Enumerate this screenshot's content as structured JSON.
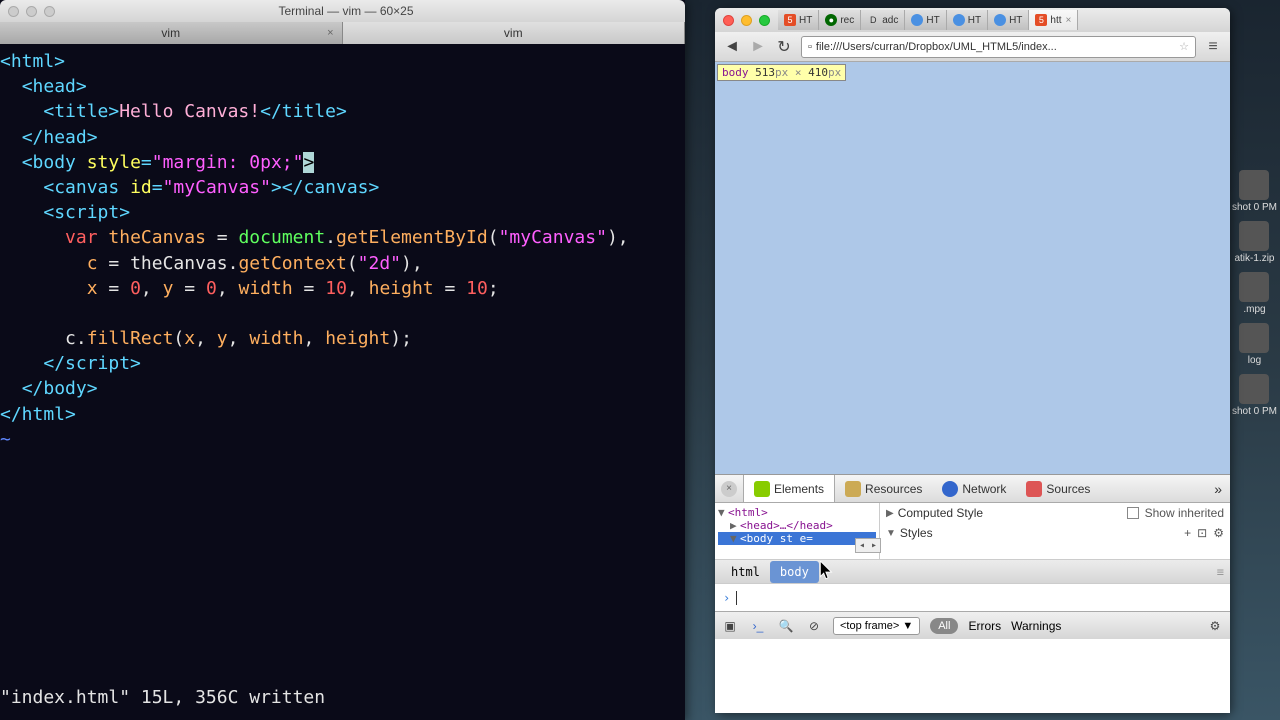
{
  "terminal": {
    "title": "Terminal — vim — 60×25",
    "tabs": [
      {
        "label": "vim",
        "active": false
      },
      {
        "label": "vim",
        "active": true
      }
    ],
    "code": {
      "title_text": "Hello Canvas!",
      "body_style": "\"margin: 0px;\"",
      "canvas_id": "\"myCanvas\"",
      "var_kw": "var",
      "theCanvas": "theCanvas",
      "doc": "document",
      "getEl": "getElementById",
      "canvas_arg": "\"myCanvas\"",
      "ctx_var": "c",
      "getCtx": "getContext",
      "ctx_arg": "\"2d\"",
      "x_init": "x = 0",
      "y_init": "y = 0",
      "w_init": "width = 10",
      "h_init": "height = 10",
      "fillrect": "fillRect",
      "fr_args": "x, y, width, height"
    },
    "status": "\"index.html\" 15L, 356C written"
  },
  "browser": {
    "tabs": [
      {
        "label": "HT",
        "icon": "html5"
      },
      {
        "label": "rec",
        "icon": "green"
      },
      {
        "label": "adc",
        "icon": "D"
      },
      {
        "label": "HT",
        "icon": "globe"
      },
      {
        "label": "HT",
        "icon": "globe"
      },
      {
        "label": "HT",
        "icon": "globe"
      },
      {
        "label": "htt",
        "icon": "html5"
      }
    ],
    "url": "file:///Users/curran/Dropbox/UML_HTML5/index...",
    "body_overlay": {
      "tag": "body",
      "w": "513",
      "h": "410",
      "unit": "px"
    },
    "devtools": {
      "tabs": [
        "Elements",
        "Resources",
        "Network",
        "Sources"
      ],
      "tree": {
        "html": "<html>",
        "head": "<head>…</head>",
        "body": "<body st  e="
      },
      "styles": {
        "computed": "Computed Style",
        "show_inherited": "Show inherited",
        "styles_hdr": "Styles"
      },
      "crumbs": [
        "html",
        "body"
      ],
      "console_prompt": "›",
      "footer": {
        "frame": "<top frame>",
        "all": "All",
        "errors": "Errors",
        "warnings": "Warnings"
      }
    }
  },
  "desktop": {
    "items": [
      "shot 0 PM",
      "atik-1.zip",
      ".mpg",
      "log",
      "shot 0 PM"
    ]
  }
}
